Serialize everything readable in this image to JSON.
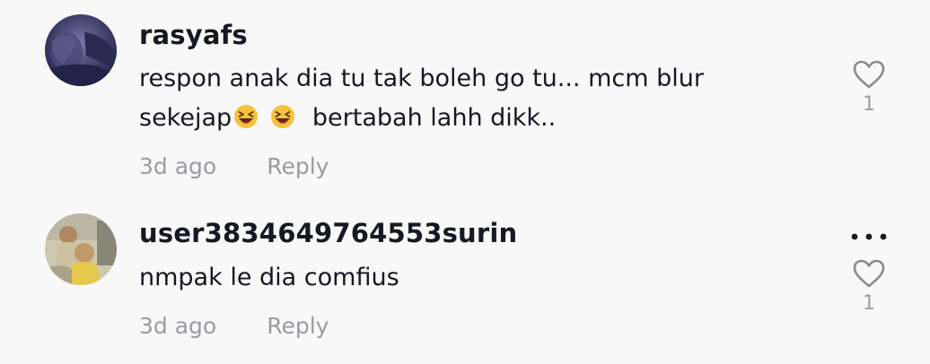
{
  "comments": [
    {
      "username": "rasyafs",
      "text_line1": "respon anak dia tu tak boleh go tu... mcm blur",
      "text_line2_prefix": "sekejap",
      "text_line2_suffix": "bertabah lahh dikk..",
      "emoji": "grinning-squinting-face",
      "time": "3d ago",
      "reply_label": "Reply",
      "likes": "1",
      "avatar": "dark-profile-photo"
    },
    {
      "username": "user3834649764553surin",
      "text_line1": "nmpak le dia comfius",
      "time": "3d ago",
      "reply_label": "Reply",
      "likes": "1",
      "avatar": "children-photo"
    }
  ],
  "colors": {
    "background": "#f8f8f8",
    "primary_text": "#161823",
    "secondary_text": "#9b9ba1"
  }
}
